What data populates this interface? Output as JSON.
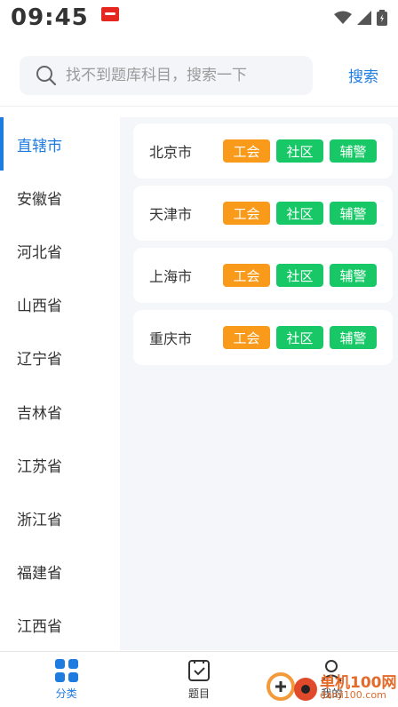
{
  "status": {
    "time": "09:45"
  },
  "search": {
    "placeholder": "找不到题库科目，搜索一下",
    "button": "搜索"
  },
  "sidebar": {
    "items": [
      {
        "label": "直辖市",
        "active": true
      },
      {
        "label": "安徽省"
      },
      {
        "label": "河北省"
      },
      {
        "label": "山西省"
      },
      {
        "label": "辽宁省"
      },
      {
        "label": "吉林省"
      },
      {
        "label": "江苏省"
      },
      {
        "label": "浙江省"
      },
      {
        "label": "福建省"
      },
      {
        "label": "江西省"
      }
    ]
  },
  "cities": [
    {
      "name": "北京市",
      "tags": [
        "工会",
        "社区",
        "辅警"
      ]
    },
    {
      "name": "天津市",
      "tags": [
        "工会",
        "社区",
        "辅警"
      ]
    },
    {
      "name": "上海市",
      "tags": [
        "工会",
        "社区",
        "辅警"
      ]
    },
    {
      "name": "重庆市",
      "tags": [
        "工会",
        "社区",
        "辅警"
      ]
    }
  ],
  "tags_colors": {
    "工会": "#f99a1a",
    "社区": "#18c867",
    "辅警": "#18c867"
  },
  "tabbar": {
    "items": [
      {
        "label": "分类",
        "icon": "grid-icon",
        "active": true
      },
      {
        "label": "题目",
        "icon": "checklist-icon"
      },
      {
        "label": "我的",
        "icon": "user-icon"
      }
    ]
  },
  "watermark": {
    "text": "单机100网",
    "sub": "danji100.com"
  },
  "colors": {
    "accent": "#1e7be0",
    "orange": "#f99a1a",
    "green": "#18c867"
  }
}
